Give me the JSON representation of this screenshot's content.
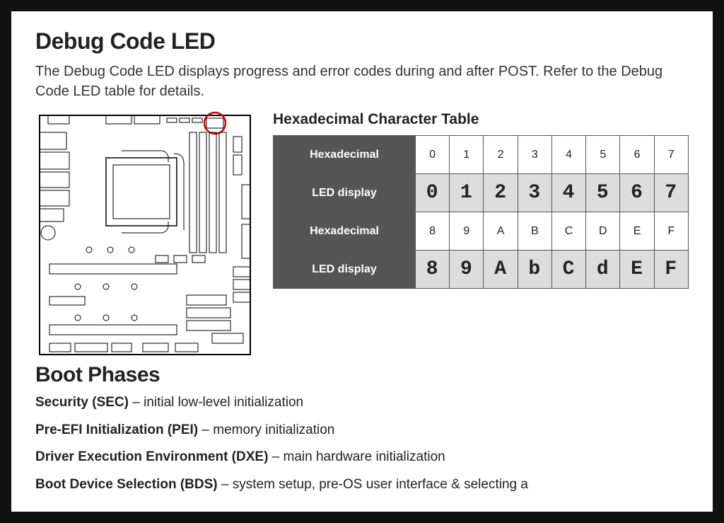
{
  "title": "Debug Code LED",
  "intro": "The Debug Code LED displays progress and error codes during and after POST. Refer to the Debug Code LED table for details.",
  "table_title": "Hexadecimal Character Table",
  "hex_table": {
    "label_hex": "Hexadecimal",
    "label_led": "LED display",
    "row1_hex": [
      "0",
      "1",
      "2",
      "3",
      "4",
      "5",
      "6",
      "7"
    ],
    "row1_led": [
      "0",
      "1",
      "2",
      "3",
      "4",
      "5",
      "6",
      "7"
    ],
    "row2_hex": [
      "8",
      "9",
      "A",
      "B",
      "C",
      "D",
      "E",
      "F"
    ],
    "row2_led": [
      "8",
      "9",
      "A",
      "b",
      "C",
      "d",
      "E",
      "F"
    ]
  },
  "boot_title": "Boot Phases",
  "phases": [
    {
      "name": "Security (SEC)",
      "desc": " – initial low-level initialization"
    },
    {
      "name": "Pre-EFI Initialization (PEI)",
      "desc": " – memory initialization"
    },
    {
      "name": "Driver Execution Environment (DXE)",
      "desc": " – main hardware initialization"
    },
    {
      "name": "Boot Device Selection (BDS)",
      "desc": " – system setup, pre-OS user interface & selecting a"
    }
  ]
}
